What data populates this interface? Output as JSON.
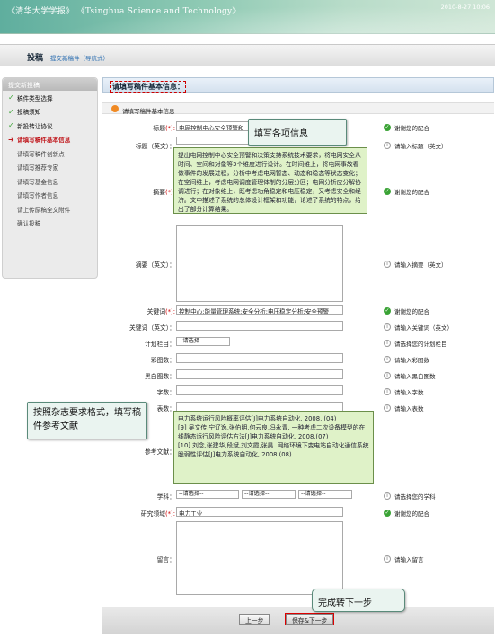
{
  "header": {
    "title": "《清华大学学报》 《Tsinghua Science and Technology》",
    "date": "2010-8-27 10:06"
  },
  "page": {
    "title": "投稿",
    "breadcrumb": "提交新稿件（导航式）"
  },
  "sidebar": {
    "head": "提交新投稿",
    "items": [
      {
        "label": "稿件类型选择",
        "state": "done"
      },
      {
        "label": "投稿须知",
        "state": "done"
      },
      {
        "label": "新投转让协议",
        "state": "done"
      },
      {
        "label": "请填写稿件基本信息",
        "state": "current"
      },
      {
        "label": "请填写稿件创新点",
        "state": "sub"
      },
      {
        "label": "请填写推荐专家",
        "state": "sub"
      },
      {
        "label": "请填写基金信息",
        "state": "sub"
      },
      {
        "label": "请填写作者信息",
        "state": "sub"
      },
      {
        "label": "请上传原稿全文附件",
        "state": "sub"
      },
      {
        "label": "确认投稿",
        "state": "sub"
      }
    ]
  },
  "form": {
    "header": "请填写稿件基本信息：",
    "subheader": "请填写稿件基本信息",
    "fields": {
      "title": {
        "label": "标题",
        "value": "电网控制中心安全预警和",
        "hint": "谢谢您的配合"
      },
      "title_en": {
        "label": "标题（英文）：",
        "hint": "请输入标题（英文）"
      },
      "abstract": {
        "label": "摘要",
        "value": "提出电网控制中心安全预警和决策支持系统技术要求",
        "hint": "谢谢您的配合"
      },
      "abstract_en": {
        "label": "摘要（英文）：",
        "hint": "请输入摘要（英文）"
      },
      "keywords": {
        "label": "关键词",
        "value": "控制中心;能量管理系统;安全分析;电压稳定分析;安全预警",
        "hint": "谢谢您的配合"
      },
      "keywords_en": {
        "label": "关键词（英文）：",
        "hint": "请输入关键词（英文）"
      },
      "column": {
        "label": "计划栏目：",
        "value": "--请选择--",
        "hint": "请选择您的计划栏目"
      },
      "color_fig": {
        "label": "彩图数：",
        "hint": "请输入彩图数"
      },
      "bw_fig": {
        "label": "黑白图数：",
        "hint": "请输入黑白图数"
      },
      "words": {
        "label": "字数：",
        "hint": "请输入字数"
      },
      "tables": {
        "label": "表数：",
        "hint": "请输入表数"
      },
      "refs": {
        "label": "参考文献："
      },
      "subject": {
        "label": "学科：",
        "sel1": "--请选择--",
        "sel2": "--请选择--",
        "sel3": "--请选择--",
        "hint": "请选择您的学科"
      },
      "field": {
        "label": "研究领域",
        "value": "电力工业",
        "hint": "谢谢您的配合"
      },
      "message": {
        "label": "留言：",
        "hint": "请输入留言"
      }
    },
    "req_mark": "(*):",
    "prev": "上一步",
    "next": "保存&下一步"
  },
  "tips": {
    "abstract": "提出电网控制中心安全预警和决策支持系统技术要求，将电网安全从时间、空间和对象等3个维度进行设计。在时间维上，将电网事故看做事件的发展过程，分析中考虑电网暂态、动态和稳态等状态变化；在空间维上，考虑电网调度管理体制的分层分区；电网分析应分解协调进行；在对象维上，既考虑功角稳定和电压稳定，又考虑安全和经济。文中描述了系统的总体设计框架和功能，论述了系统的特点，给出了部分计算结果。",
    "refs": "电力系统运行风险概率评估[J]电力系统自动化, 2008, (04)\n[9] 吴文传,宁辽逸,张伯明,何云良,冯永青. 一种考虑二次设备模型的在线静态运行风险评估方法[J]电力系统自动化, 2008,(07)\n[10] 刘念,张建华,段斌,刘文霞,张昊. 网络环境下变电站自动化通信系统脆弱性评估[J]电力系统自动化, 2008,(08)"
  },
  "callouts": {
    "fill_info": "填写各项信息",
    "refs": "按照杂志要求格式，填写稿件参考文献",
    "next": "完成转下一步"
  }
}
